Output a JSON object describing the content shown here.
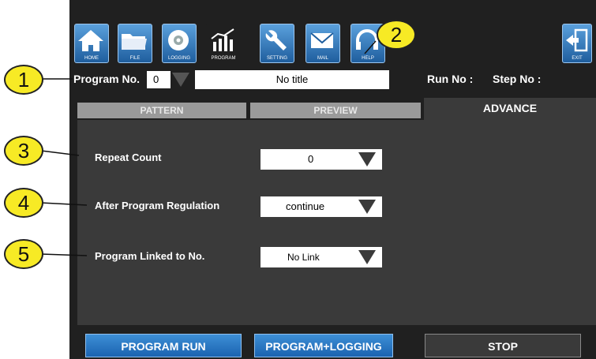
{
  "toolbar": {
    "buttons": [
      {
        "label": "HOME",
        "icon": "home-icon"
      },
      {
        "label": "FILE",
        "icon": "folder-icon"
      },
      {
        "label": "LOGGING",
        "icon": "disc-icon"
      },
      {
        "label": "PROGRAM",
        "icon": "chart-icon"
      },
      {
        "label": "SETTING",
        "icon": "wrench-icon"
      },
      {
        "label": "MAIL",
        "icon": "mail-icon"
      },
      {
        "label": "HELP",
        "icon": "headset-icon"
      },
      {
        "label": "EXIT",
        "icon": "exit-icon"
      }
    ]
  },
  "header": {
    "program_no_label": "Program No.",
    "program_no_value": "0",
    "title_value": "No title",
    "run_no_label": "Run No :",
    "step_no_label": "Step No :"
  },
  "tabs": {
    "pattern": "PATTERN",
    "preview": "PREVIEW",
    "advance": "ADVANCE"
  },
  "fields": {
    "repeat_count_label": "Repeat Count",
    "repeat_count_value": "0",
    "after_regulation_label": "After Program Regulation",
    "after_regulation_value": "continue",
    "linked_label": "Program Linked to No.",
    "linked_value": "No Link"
  },
  "bottom": {
    "run": "PROGRAM RUN",
    "run_logging": "PROGRAM+LOGGING",
    "stop": "STOP"
  },
  "callouts": [
    "1",
    "2",
    "3",
    "4",
    "5"
  ],
  "colors": {
    "panel_bg": "#202020",
    "content_bg": "#3a3a3a",
    "button_blue": "#1b63b0",
    "callout_yellow": "#f7ea25"
  }
}
